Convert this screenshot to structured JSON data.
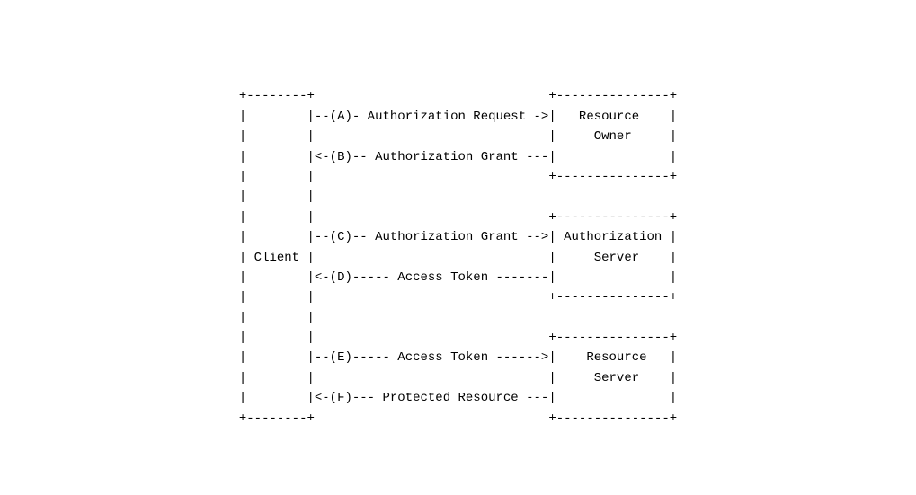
{
  "diagram": {
    "left_entity": "Client",
    "right_entities": {
      "first": {
        "line1": "Resource",
        "line2": "Owner"
      },
      "second": {
        "line1": "Authorization",
        "line2": "Server"
      },
      "third": {
        "line1": "Resource",
        "line2": "Server"
      }
    },
    "flows": {
      "a": {
        "label": "(A)",
        "text": "Authorization Request",
        "direction": "->"
      },
      "b": {
        "label": "(B)",
        "text": "Authorization Grant",
        "direction": "<-"
      },
      "c": {
        "label": "(C)",
        "text": "Authorization Grant",
        "direction": "->"
      },
      "d": {
        "label": "(D)",
        "text": "Access Token",
        "direction": "<-"
      },
      "e": {
        "label": "(E)",
        "text": "Access Token",
        "direction": "->"
      },
      "f": {
        "label": "(F)",
        "text": "Protected Resource",
        "direction": "<-"
      }
    },
    "lines": {
      "l01": "+--------+                               +---------------+",
      "l02": "|        |--(A)- Authorization Request ->|   Resource    |",
      "l03": "|        |                               |     Owner     |",
      "l04": "|        |<-(B)-- Authorization Grant ---|               |",
      "l05": "|        |                               +---------------+",
      "l06": "|        |",
      "l07": "|        |                               +---------------+",
      "l08": "|        |--(C)-- Authorization Grant -->| Authorization |",
      "l09": "| Client |                               |     Server    |",
      "l10": "|        |<-(D)----- Access Token -------|               |",
      "l11": "|        |                               +---------------+",
      "l12": "|        |",
      "l13": "|        |                               +---------------+",
      "l14": "|        |--(E)----- Access Token ------>|    Resource   |",
      "l15": "|        |                               |     Server    |",
      "l16": "|        |<-(F)--- Protected Resource ---|               |",
      "l17": "+--------+                               +---------------+"
    }
  }
}
